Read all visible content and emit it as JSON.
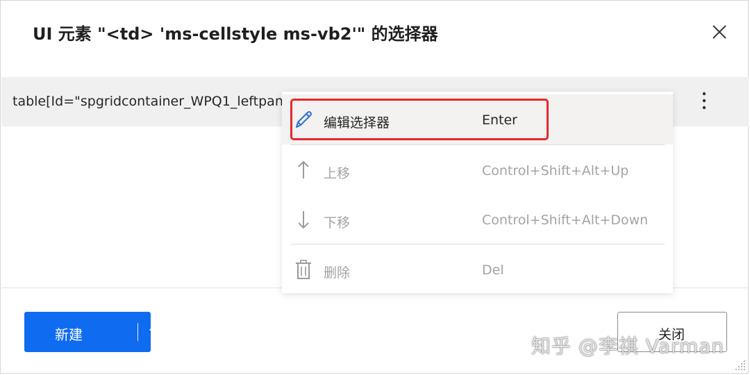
{
  "dialog": {
    "title": "UI 元素 \"<td> 'ms-cellstyle ms-vb2'\" 的选择器"
  },
  "selector": {
    "text": "table[Id=\"spgridcontainer_WPQ1_leftpane\"]"
  },
  "context_menu": {
    "items": [
      {
        "icon": "pencil-icon",
        "label": "编辑选择器",
        "shortcut": "Enter",
        "enabled": true
      },
      {
        "icon": "arrow-up-icon",
        "label": "上移",
        "shortcut": "Control+Shift+Alt+Up",
        "enabled": false
      },
      {
        "icon": "arrow-down-icon",
        "label": "下移",
        "shortcut": "Control+Shift+Alt+Down",
        "enabled": false
      },
      {
        "icon": "trash-icon",
        "label": "删除",
        "shortcut": "Del",
        "enabled": false
      }
    ]
  },
  "footer": {
    "new_label": "新建",
    "close_label": "关闭"
  },
  "watermark": "知乎 @李祺 Varman",
  "colors": {
    "primary": "#0f6cf0",
    "annotation": "#e8272a",
    "disabled_text": "#a3a3a3"
  }
}
